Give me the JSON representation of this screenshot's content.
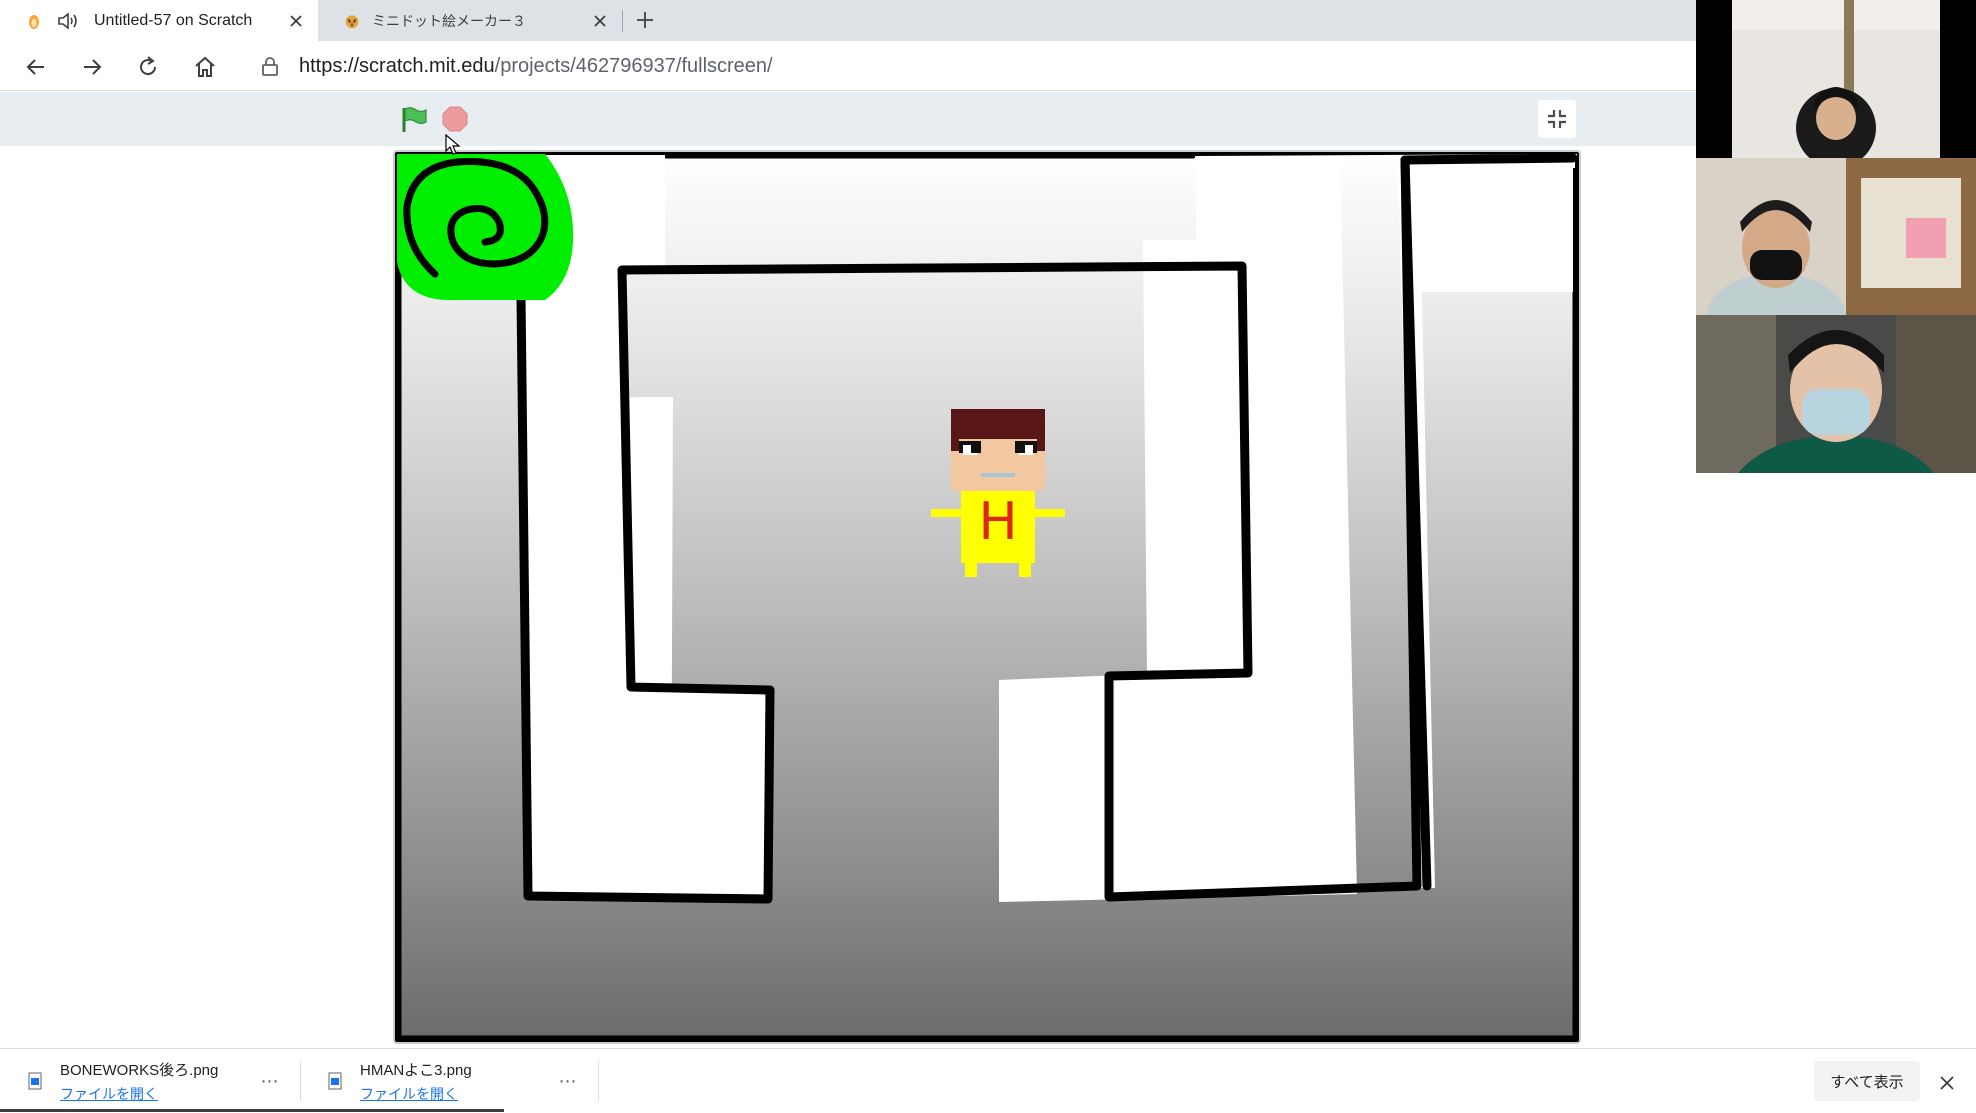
{
  "tabs": [
    {
      "title": "Untitled-57 on Scratch",
      "active": true,
      "favicon": "scratch-cat-icon",
      "audio": true
    },
    {
      "title": "ミニドット絵メーカー３",
      "active": false,
      "favicon": "tiger-icon"
    }
  ],
  "address_bar": {
    "url_host": "https://scratch.mit.edu",
    "url_path": "/projects/462796937/fullscreen/"
  },
  "scratch": {
    "controls": [
      "green-flag-icon",
      "stop-icon"
    ],
    "unfullscreen": "unfullscreen-icon",
    "sprite_letter": "H"
  },
  "video_tiles": 3,
  "downloads": [
    {
      "filename": "BONEWORKS後ろ.png",
      "action": "ファイルを開く"
    },
    {
      "filename": "HMANよこ3.png",
      "action": "ファイルを開く"
    }
  ],
  "show_all_label": "すべて表示",
  "colors": {
    "tab_strip": "#dee1e6",
    "scratch_bar": "#e8edf1",
    "goal_green": "#00ee00",
    "sprite_yellow": "#ffff00",
    "sprite_letter": "#e0241f",
    "link_blue": "#1a73e8"
  }
}
